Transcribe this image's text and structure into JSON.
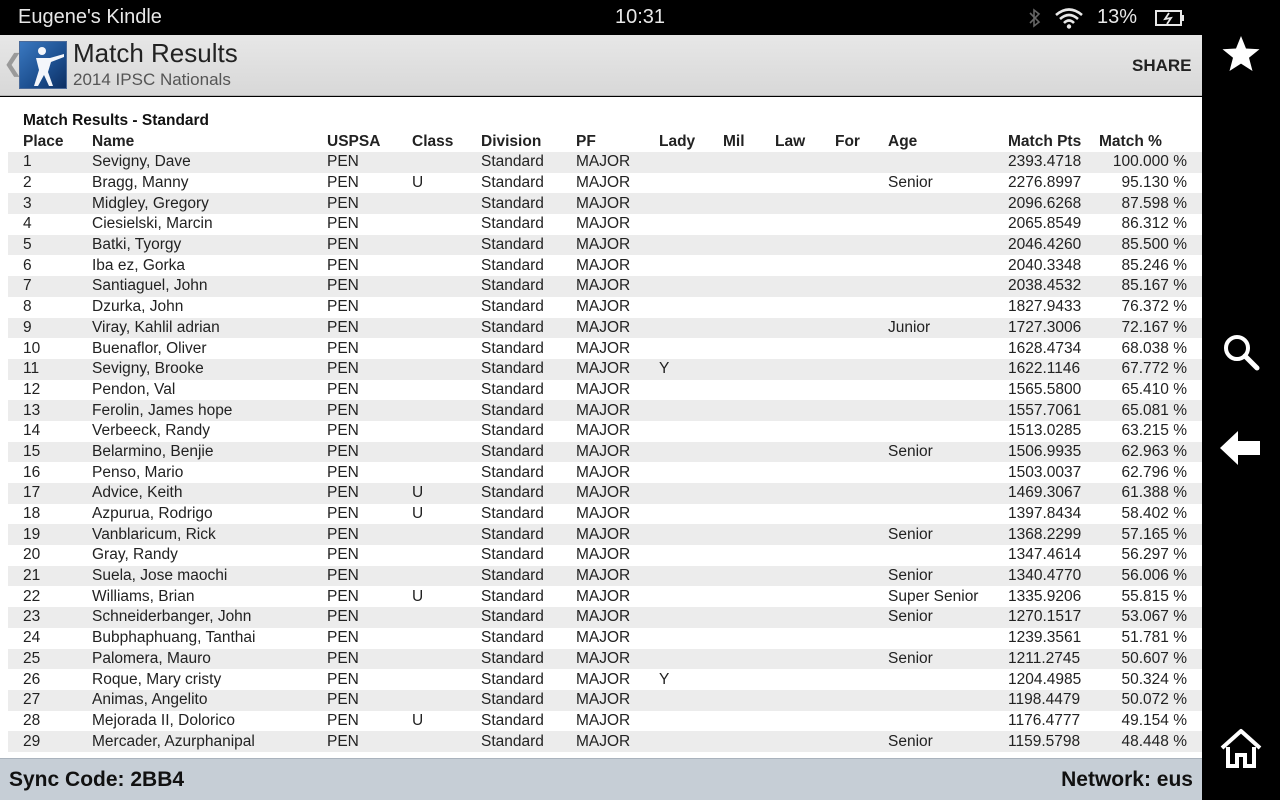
{
  "status_bar": {
    "device_name": "Eugene's Kindle",
    "time": "10:31",
    "battery": "13%"
  },
  "header": {
    "title": "Match Results",
    "subtitle": "2014 IPSC Nationals",
    "share_label": "SHARE",
    "back_icon": "chevron-left-icon",
    "logo_icon": "shooter-logo"
  },
  "results": {
    "caption": "Match Results - Standard",
    "columns": [
      "Place",
      "Name",
      "USPSA",
      "Class",
      "Division",
      "PF",
      "Lady",
      "Mil",
      "Law",
      "For",
      "Age",
      "Match Pts",
      "Match %"
    ],
    "rows": [
      [
        "1",
        "Sevigny, Dave",
        "PEN",
        "",
        "Standard",
        "MAJOR",
        "",
        "",
        "",
        "",
        "",
        "2393.4718",
        "100.000 %"
      ],
      [
        "2",
        "Bragg, Manny",
        "PEN",
        "U",
        "Standard",
        "MAJOR",
        "",
        "",
        "",
        "",
        "Senior",
        "2276.8997",
        "95.130 %"
      ],
      [
        "3",
        "Midgley, Gregory",
        "PEN",
        "",
        "Standard",
        "MAJOR",
        "",
        "",
        "",
        "",
        "",
        "2096.6268",
        "87.598 %"
      ],
      [
        "4",
        "Ciesielski, Marcin",
        "PEN",
        "",
        "Standard",
        "MAJOR",
        "",
        "",
        "",
        "",
        "",
        "2065.8549",
        "86.312 %"
      ],
      [
        "5",
        "Batki, Tyorgy",
        "PEN",
        "",
        "Standard",
        "MAJOR",
        "",
        "",
        "",
        "",
        "",
        "2046.4260",
        "85.500 %"
      ],
      [
        "6",
        "Iba ez, Gorka",
        "PEN",
        "",
        "Standard",
        "MAJOR",
        "",
        "",
        "",
        "",
        "",
        "2040.3348",
        "85.246 %"
      ],
      [
        "7",
        "Santiaguel, John",
        "PEN",
        "",
        "Standard",
        "MAJOR",
        "",
        "",
        "",
        "",
        "",
        "2038.4532",
        "85.167 %"
      ],
      [
        "8",
        "Dzurka, John",
        "PEN",
        "",
        "Standard",
        "MAJOR",
        "",
        "",
        "",
        "",
        "",
        "1827.9433",
        "76.372 %"
      ],
      [
        "9",
        "Viray, Kahlil adrian",
        "PEN",
        "",
        "Standard",
        "MAJOR",
        "",
        "",
        "",
        "",
        "Junior",
        "1727.3006",
        "72.167 %"
      ],
      [
        "10",
        "Buenaflor, Oliver",
        "PEN",
        "",
        "Standard",
        "MAJOR",
        "",
        "",
        "",
        "",
        "",
        "1628.4734",
        "68.038 %"
      ],
      [
        "11",
        "Sevigny, Brooke",
        "PEN",
        "",
        "Standard",
        "MAJOR",
        "Y",
        "",
        "",
        "",
        "",
        "1622.1146",
        "67.772 %"
      ],
      [
        "12",
        "Pendon, Val",
        "PEN",
        "",
        "Standard",
        "MAJOR",
        "",
        "",
        "",
        "",
        "",
        "1565.5800",
        "65.410 %"
      ],
      [
        "13",
        "Ferolin, James hope",
        "PEN",
        "",
        "Standard",
        "MAJOR",
        "",
        "",
        "",
        "",
        "",
        "1557.7061",
        "65.081 %"
      ],
      [
        "14",
        "Verbeeck, Randy",
        "PEN",
        "",
        "Standard",
        "MAJOR",
        "",
        "",
        "",
        "",
        "",
        "1513.0285",
        "63.215 %"
      ],
      [
        "15",
        "Belarmino, Benjie",
        "PEN",
        "",
        "Standard",
        "MAJOR",
        "",
        "",
        "",
        "",
        "Senior",
        "1506.9935",
        "62.963 %"
      ],
      [
        "16",
        "Penso, Mario",
        "PEN",
        "",
        "Standard",
        "MAJOR",
        "",
        "",
        "",
        "",
        "",
        "1503.0037",
        "62.796 %"
      ],
      [
        "17",
        "Advice, Keith",
        "PEN",
        "U",
        "Standard",
        "MAJOR",
        "",
        "",
        "",
        "",
        "",
        "1469.3067",
        "61.388 %"
      ],
      [
        "18",
        "Azpurua, Rodrigo",
        "PEN",
        "U",
        "Standard",
        "MAJOR",
        "",
        "",
        "",
        "",
        "",
        "1397.8434",
        "58.402 %"
      ],
      [
        "19",
        "Vanblaricum, Rick",
        "PEN",
        "",
        "Standard",
        "MAJOR",
        "",
        "",
        "",
        "",
        "Senior",
        "1368.2299",
        "57.165 %"
      ],
      [
        "20",
        "Gray, Randy",
        "PEN",
        "",
        "Standard",
        "MAJOR",
        "",
        "",
        "",
        "",
        "",
        "1347.4614",
        "56.297 %"
      ],
      [
        "21",
        "Suela, Jose maochi",
        "PEN",
        "",
        "Standard",
        "MAJOR",
        "",
        "",
        "",
        "",
        "Senior",
        "1340.4770",
        "56.006 %"
      ],
      [
        "22",
        "Williams, Brian",
        "PEN",
        "U",
        "Standard",
        "MAJOR",
        "",
        "",
        "",
        "",
        "Super Senior",
        "1335.9206",
        "55.815 %"
      ],
      [
        "23",
        "Schneiderbanger, John",
        "PEN",
        "",
        "Standard",
        "MAJOR",
        "",
        "",
        "",
        "",
        "Senior",
        "1270.1517",
        "53.067 %"
      ],
      [
        "24",
        "Bubphaphuang, Tanthai",
        "PEN",
        "",
        "Standard",
        "MAJOR",
        "",
        "",
        "",
        "",
        "",
        "1239.3561",
        "51.781 %"
      ],
      [
        "25",
        "Palomera, Mauro",
        "PEN",
        "",
        "Standard",
        "MAJOR",
        "",
        "",
        "",
        "",
        "Senior",
        "1211.2745",
        "50.607 %"
      ],
      [
        "26",
        "Roque, Mary cristy",
        "PEN",
        "",
        "Standard",
        "MAJOR",
        "Y",
        "",
        "",
        "",
        "",
        "1204.4985",
        "50.324 %"
      ],
      [
        "27",
        "Animas, Angelito",
        "PEN",
        "",
        "Standard",
        "MAJOR",
        "",
        "",
        "",
        "",
        "",
        "1198.4479",
        "50.072 %"
      ],
      [
        "28",
        "Mejorada II, Dolorico",
        "PEN",
        "U",
        "Standard",
        "MAJOR",
        "",
        "",
        "",
        "",
        "",
        "1176.4777",
        "49.154 %"
      ],
      [
        "29",
        "Mercader, Azurphanipal",
        "PEN",
        "",
        "Standard",
        "MAJOR",
        "",
        "",
        "",
        "",
        "Senior",
        "1159.5798",
        "48.448 %"
      ]
    ]
  },
  "footer": {
    "sync_code": "Sync Code: 2BB4",
    "network": "Network: eus"
  },
  "right_nav": {
    "buttons": [
      "star-icon",
      "search-icon",
      "back-arrow-icon",
      "home-icon"
    ]
  },
  "colors": {
    "header_bg": "#dedede",
    "footer_bg": "#c6ced6",
    "row_stripe": "#ececec",
    "nav_bg": "#000000"
  }
}
